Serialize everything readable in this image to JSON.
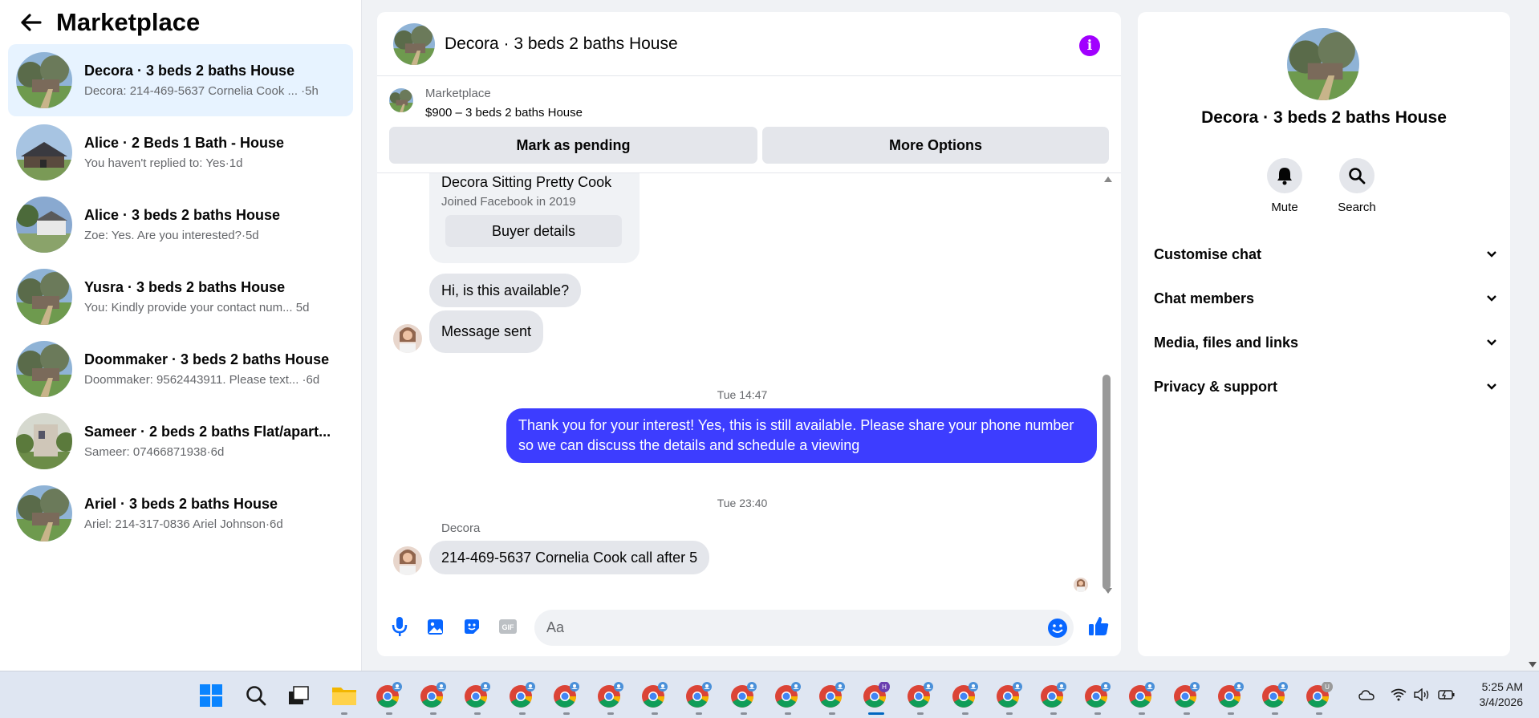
{
  "sidebar": {
    "title": "Marketplace",
    "conversations": [
      {
        "title": "Decora · 3 beds 2 baths House",
        "snippet": "Decora: 214-469-5637 Cornelia Cook ... ·5h"
      },
      {
        "title": "Alice · 2 Beds 1 Bath - House",
        "snippet": "You haven't replied to: Yes·1d"
      },
      {
        "title": "Alice · 3 beds 2 baths House",
        "snippet": "Zoe: Yes. Are you interested?·5d"
      },
      {
        "title": "Yusra · 3 beds 2 baths House",
        "snippet": "You: Kindly provide your contact num...   5d"
      },
      {
        "title": "Doommaker · 3 beds 2 baths House",
        "snippet": "Doommaker: 9562443911. Please text... ·6d"
      },
      {
        "title": "Sameer · 2 beds 2 baths Flat/apart...",
        "snippet": "Sameer: 07466871938·6d"
      },
      {
        "title": "Ariel · 3 beds 2 baths House",
        "snippet": "Ariel: 214-317-0836 Ariel Johnson·6d"
      }
    ]
  },
  "chat": {
    "title": "Decora · 3 beds 2 baths House",
    "listing_source": "Marketplace",
    "listing_price": "$900 – 3 beds 2 baths House",
    "mark_pending": "Mark as pending",
    "more_options": "More Options",
    "buyer_name": "Decora Sitting Pretty Cook",
    "buyer_joined": "Joined Facebook in 2019",
    "buyer_details": "Buyer details",
    "msg_available": "Hi, is this available?",
    "msg_sent": "Message sent",
    "ts1": "Tue 14:47",
    "my_reply": "Thank you for your interest! Yes, this is still available. Please share your phone number so we can discuss the details and schedule a viewing",
    "ts2": "Tue 23:40",
    "sender_label": "Decora",
    "last_msg": "214-469-5637 Cornelia Cook call after 5",
    "input_placeholder": "Aa",
    "accent_color": "#3d3dff"
  },
  "right_panel": {
    "title": "Decora · 3 beds 2 baths House",
    "mute": "Mute",
    "search": "Search",
    "sections": [
      "Customise chat",
      "Chat members",
      "Media, files and links",
      "Privacy & support"
    ]
  },
  "taskbar": {
    "time": "5:25 AM",
    "date": "3/4/2026",
    "apps": [
      "windows-start",
      "search",
      "task-view",
      "file-explorer",
      "chrome",
      "chrome",
      "chrome",
      "chrome",
      "chrome",
      "chrome",
      "chrome",
      "chrome",
      "chrome",
      "chrome",
      "chrome",
      "chrome-active",
      "chrome",
      "chrome",
      "chrome",
      "chrome",
      "chrome",
      "chrome",
      "chrome",
      "chrome",
      "chrome",
      "chrome"
    ],
    "active_badge": "H",
    "last_badge": "U"
  }
}
